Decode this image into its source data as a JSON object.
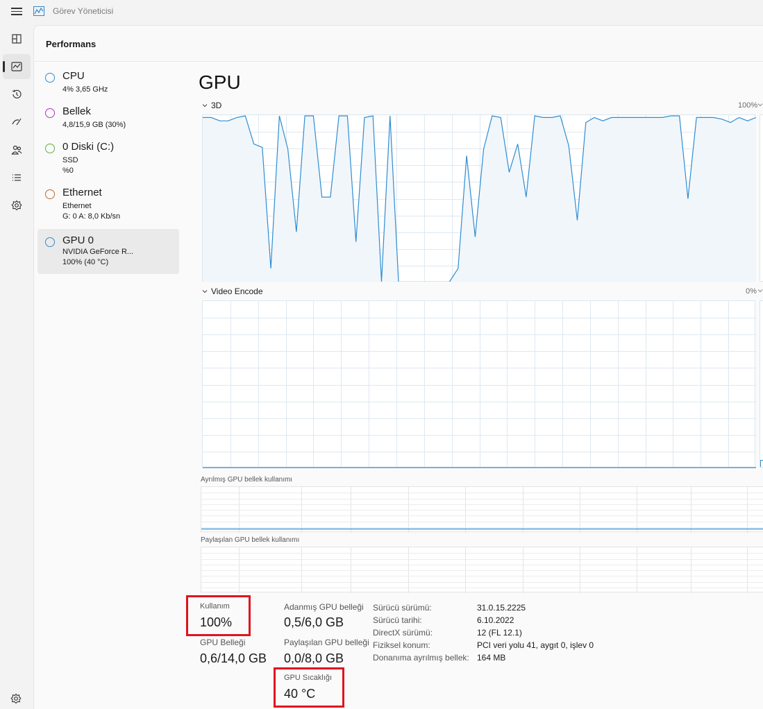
{
  "window": {
    "title": "Görev Yöneticisi"
  },
  "panel": {
    "title": "Performans"
  },
  "rail": [
    "processes-icon",
    "performance-icon",
    "app-history-icon",
    "startup-icon",
    "users-icon",
    "details-icon",
    "services-icon"
  ],
  "devices": [
    {
      "name": "CPU",
      "lines": [
        "4% 3,65 GHz"
      ],
      "color": "#2f8dd0"
    },
    {
      "name": "Bellek",
      "lines": [
        "4,8/15,9 GB (30%)"
      ],
      "color": "#b233c4"
    },
    {
      "name": "0 Diski (C:)",
      "lines": [
        "SSD",
        "%0"
      ],
      "color": "#5fb03a"
    },
    {
      "name": "Ethernet",
      "lines": [
        "Ethernet",
        "G: 0 A: 8,0 Kb/sn"
      ],
      "color": "#c0672a"
    },
    {
      "name": "GPU 0",
      "lines": [
        "NVIDIA GeForce R...",
        "100% (40 °C)"
      ],
      "color": "#2f8dd0"
    }
  ],
  "main": {
    "title": "GPU",
    "chart3d": {
      "label": "3D",
      "max": "100%"
    },
    "chartEncode": {
      "label": "Video Encode",
      "max": "0%"
    },
    "dedicated_mem_label": "Ayrılmış GPU bellek kullanımı",
    "shared_mem_label": "Paylaşılan GPU bellek kullanımı"
  },
  "stats": {
    "usage_label": "Kullanım",
    "usage_value": "100%",
    "gpu_mem_label": "GPU Belleği",
    "gpu_mem_value": "0,6/14,0 GB",
    "dedicated_label": "Adanmış GPU belleği",
    "dedicated_value": "0,5/6,0 GB",
    "shared_label": "Paylaşılan GPU belleği",
    "shared_value": "0,0/8,0 GB",
    "temp_label": "GPU Sıcaklığı",
    "temp_value": "40 °C"
  },
  "info": [
    {
      "key": "Sürücü sürümü:",
      "value": "31.0.15.2225"
    },
    {
      "key": "Sürücü tarihi:",
      "value": "6.10.2022"
    },
    {
      "key": "DirectX sürümü:",
      "value": "12 (FL 12.1)"
    },
    {
      "key": "Fiziksel konum:",
      "value": "PCI veri yolu 41, aygıt 0, işlev 0"
    },
    {
      "key": "Donanıma ayrılmış bellek:",
      "value": "164 MB"
    }
  ],
  "chart_data": [
    {
      "type": "area",
      "title": "3D",
      "ylim": [
        0,
        100
      ],
      "values": [
        99,
        99,
        97,
        97,
        99,
        100,
        83,
        81,
        8,
        100,
        80,
        30,
        100,
        100,
        51,
        51,
        100,
        100,
        24,
        99,
        100,
        0,
        100,
        0,
        null,
        null,
        null,
        null,
        null,
        0,
        8,
        76,
        27,
        80,
        100,
        99,
        66,
        83,
        51,
        100,
        99,
        99,
        100,
        82,
        37,
        96,
        99,
        97,
        99,
        99,
        99,
        99,
        99,
        99,
        99,
        100,
        100,
        50,
        99,
        99,
        99,
        98,
        96,
        99,
        97,
        99
      ]
    },
    {
      "type": "area",
      "title": "Video Encode",
      "ylim": [
        0,
        100
      ],
      "values": [
        0,
        0,
        0,
        0,
        0,
        0,
        0,
        0,
        0,
        0,
        0,
        0,
        0,
        0,
        0,
        0,
        0,
        0,
        0,
        0,
        0,
        0,
        0,
        0,
        0,
        0,
        0,
        0,
        0,
        0,
        0,
        0,
        0,
        0,
        0,
        0,
        0,
        0,
        0,
        0,
        0,
        0,
        0,
        0,
        0,
        0,
        0,
        0,
        0,
        0,
        0,
        0,
        0,
        0,
        0,
        0,
        0,
        0,
        0,
        0,
        0,
        0,
        0,
        0,
        0,
        0
      ]
    }
  ]
}
